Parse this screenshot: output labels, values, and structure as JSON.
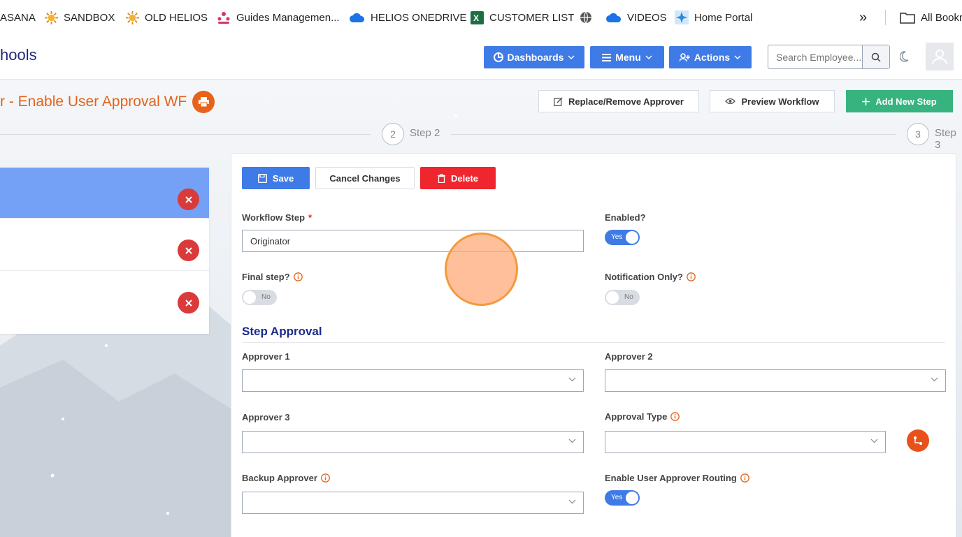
{
  "bookmarks": {
    "items": [
      {
        "label": "ASANA",
        "icon": "none"
      },
      {
        "label": "SANDBOX",
        "icon": "sun-icon"
      },
      {
        "label": "OLD HELIOS",
        "icon": "sun-icon"
      },
      {
        "label": "Guides Managemen...",
        "icon": "people-icon"
      },
      {
        "label": "HELIOS ONEDRIVE",
        "icon": "cloud-icon"
      },
      {
        "label": "CUSTOMER LIST",
        "icon": "excel-icon"
      },
      {
        "label": "",
        "icon": "globe-icon"
      },
      {
        "label": "VIDEOS",
        "icon": "cloud-icon"
      },
      {
        "label": "Home Portal",
        "icon": "star-icon"
      }
    ],
    "overflow": "»",
    "all_bookmarks": "All Bookm"
  },
  "header": {
    "brand": "hools",
    "dashboards": "Dashboards",
    "menu": "Menu",
    "actions": "Actions",
    "search_placeholder": "Search Employee..."
  },
  "page": {
    "title": "r - Enable User Approval WF",
    "replace_btn": "Replace/Remove Approver",
    "preview_btn": "Preview Workflow",
    "add_step_btn": "Add New Step"
  },
  "stepper": {
    "steps": [
      {
        "num": "2",
        "label": "Step 2"
      },
      {
        "num": "3",
        "label": "Step 3"
      }
    ]
  },
  "form": {
    "save": "Save",
    "cancel": "Cancel Changes",
    "delete": "Delete",
    "workflow_step_label": "Workflow Step",
    "required_mark": "*",
    "workflow_step_value": "Originator",
    "enabled_label": "Enabled?",
    "enabled_value": "Yes",
    "final_step_label": "Final step?",
    "final_step_value": "No",
    "notification_only_label": "Notification Only?",
    "notification_only_value": "No",
    "section_title": "Step Approval",
    "approver1_label": "Approver 1",
    "approver2_label": "Approver 2",
    "approver3_label": "Approver 3",
    "approval_type_label": "Approval Type",
    "backup_approver_label": "Backup Approver",
    "routing_label": "Enable User Approver Routing",
    "routing_value": "Yes"
  },
  "colors": {
    "primary": "#3f7be6",
    "danger": "#f0262e",
    "success": "#36b37e",
    "accent_orange": "#e2631b",
    "section_title": "#1a2b8c"
  }
}
